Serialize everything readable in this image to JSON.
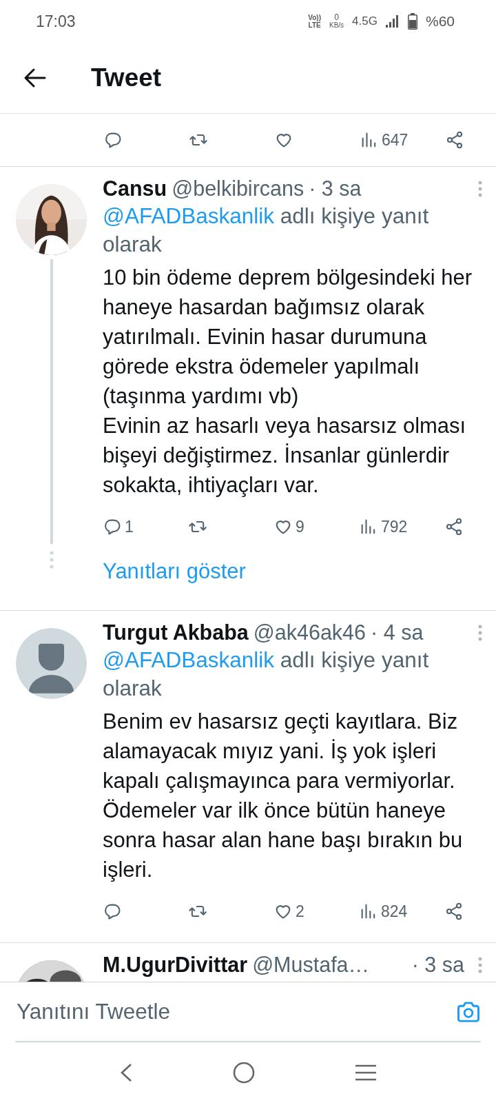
{
  "status_bar": {
    "time": "17:03",
    "volte_top": "Vo))",
    "volte_bottom": "LTE",
    "speed_value": "0",
    "speed_unit": "KB/s",
    "network": "4.5G",
    "battery": "%60"
  },
  "header": {
    "title": "Tweet"
  },
  "main_actions": [
    {
      "kind": "reply"
    },
    {
      "kind": "retweet"
    },
    {
      "kind": "like"
    },
    {
      "kind": "views",
      "count": "647"
    },
    {
      "kind": "share"
    }
  ],
  "replies": [
    {
      "name": "Cansu",
      "handle": "@belkibircans",
      "time": "· 3 sa",
      "reply_to": "@AFADBaskanlik",
      "reply_to_suffix": "adlı kişiye yanıt olarak",
      "text": "10 bin ödeme deprem bölgesindeki her haneye hasardan bağımsız olarak yatırılmalı. Evinin hasar durumuna görede ekstra ödemeler yapılmalı (taşınma yardımı vb)\nEvinin az hasarlı veya hasarsız olması bişeyi değiştirmez. İnsanlar günlerdir sokakta, ihtiyaçları var.",
      "actions": [
        {
          "kind": "reply",
          "count": "1"
        },
        {
          "kind": "retweet"
        },
        {
          "kind": "like",
          "count": "9"
        },
        {
          "kind": "views",
          "count": "792"
        },
        {
          "kind": "share"
        }
      ],
      "show_replies": "Yanıtları göster"
    },
    {
      "name": "Turgut Akbaba",
      "handle": "@ak46ak46",
      "time": "· 4 sa",
      "avatar": {
        "kind": "default"
      },
      "reply_to": "@AFADBaskanlik",
      "reply_to_suffix": "adlı kişiye yanıt olarak",
      "text": "Benim ev hasarsız geçti kayıtlara. Biz alamayacak mıyız yani. İş yok işleri kapalı çalışmayınca para vermiyorlar. Ödemeler var ilk önce bütün haneye sonra hasar alan hane başı bırakın bu işleri.",
      "actions": [
        {
          "kind": "reply"
        },
        {
          "kind": "retweet"
        },
        {
          "kind": "like",
          "count": "2"
        },
        {
          "kind": "views",
          "count": "824"
        },
        {
          "kind": "share"
        }
      ]
    },
    {
      "name": "M.UgurDivittar",
      "handle": "@Mustafa…",
      "time": "· 3 sa"
    }
  ],
  "compose": {
    "placeholder": "Yanıtını Tweetle"
  }
}
